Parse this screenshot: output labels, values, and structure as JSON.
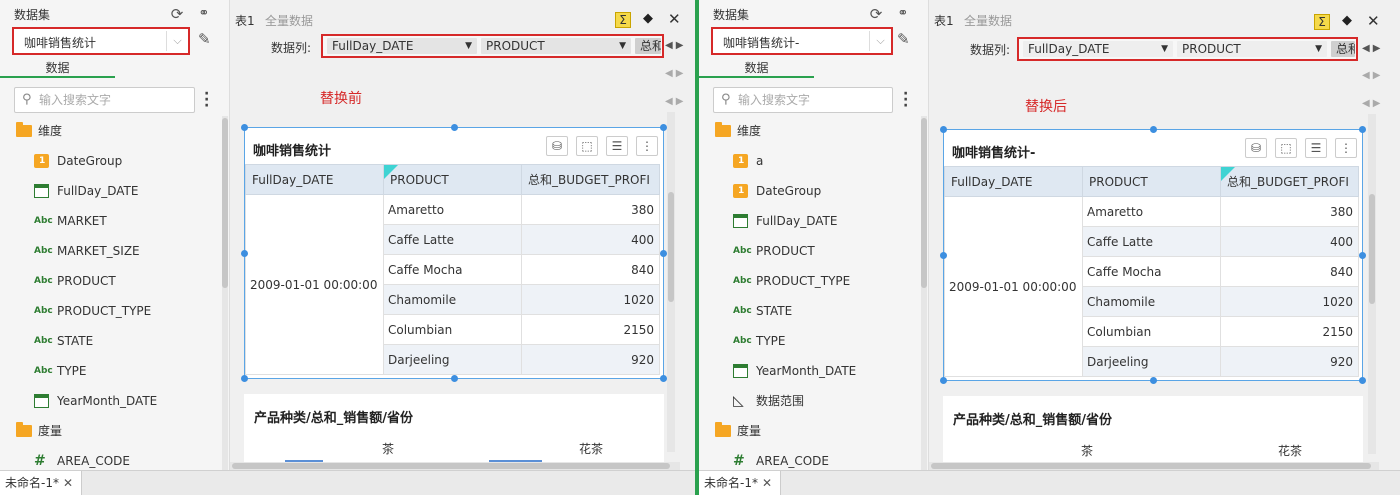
{
  "panes": [
    {
      "sidebar": {
        "title": "数据集",
        "dataset_value": "咖啡销售统计",
        "tab_label": "数据",
        "search_placeholder": "输入搜索文字",
        "tree": [
          {
            "label": "维度"
          },
          {
            "label": "DateGroup"
          },
          {
            "label": "FullDay_DATE"
          },
          {
            "label": "MARKET"
          },
          {
            "label": "MARKET_SIZE"
          },
          {
            "label": "PRODUCT"
          },
          {
            "label": "PRODUCT_TYPE"
          },
          {
            "label": "STATE"
          },
          {
            "label": "TYPE"
          },
          {
            "label": "YearMonth_DATE"
          },
          {
            "label": "度量"
          },
          {
            "label": "AREA_CODE"
          }
        ]
      },
      "topbar": {
        "tab1": "表1",
        "tab2": "全量数据",
        "sigma": "Σ"
      },
      "columns_label": "数据列:",
      "columns": [
        "FullDay_DATE",
        "PRODUCT",
        "总和"
      ],
      "note": "替换前",
      "widget": {
        "title": "咖啡销售统计",
        "headers": [
          "FullDay_DATE",
          "PRODUCT",
          "总和_BUDGET_PROFI"
        ],
        "date_cell": "2009-01-01 00:00:00",
        "rows": [
          {
            "product": "Amaretto",
            "value": "380"
          },
          {
            "product": "Caffe Latte",
            "value": "400"
          },
          {
            "product": "Caffe Mocha",
            "value": "840"
          },
          {
            "product": "Chamomile",
            "value": "1020"
          },
          {
            "product": "Columbian",
            "value": "2150"
          },
          {
            "product": "Darjeeling",
            "value": "920"
          }
        ]
      },
      "widget2": {
        "title": "产品种类/总和_销售额/省份",
        "categories": [
          "茶",
          "花茶"
        ]
      },
      "sheet_tab": "未命名-1*"
    },
    {
      "sidebar": {
        "title": "数据集",
        "dataset_value": "咖啡销售统计-",
        "tab_label": "数据",
        "search_placeholder": "输入搜索文字",
        "tree": [
          {
            "label": "维度"
          },
          {
            "label": "a"
          },
          {
            "label": "DateGroup"
          },
          {
            "label": "FullDay_DATE"
          },
          {
            "label": "PRODUCT"
          },
          {
            "label": "PRODUCT_TYPE"
          },
          {
            "label": "STATE"
          },
          {
            "label": "TYPE"
          },
          {
            "label": "YearMonth_DATE"
          },
          {
            "label": "数据范围"
          },
          {
            "label": "度量"
          },
          {
            "label": "AREA_CODE"
          }
        ]
      },
      "topbar": {
        "tab1": "表1",
        "tab2": "全量数据",
        "sigma": "Σ"
      },
      "columns_label": "数据列:",
      "columns": [
        "FullDay_DATE",
        "PRODUCT",
        "总和"
      ],
      "note": "替换后",
      "widget": {
        "title": "咖啡销售统计-",
        "headers": [
          "FullDay_DATE",
          "PRODUCT",
          "总和_BUDGET_PROFI"
        ],
        "date_cell": "2009-01-01 00:00:00",
        "rows": [
          {
            "product": "Amaretto",
            "value": "380"
          },
          {
            "product": "Caffe Latte",
            "value": "400"
          },
          {
            "product": "Caffe Mocha",
            "value": "840"
          },
          {
            "product": "Chamomile",
            "value": "1020"
          },
          {
            "product": "Columbian",
            "value": "2150"
          },
          {
            "product": "Darjeeling",
            "value": "920"
          }
        ]
      },
      "widget2": {
        "title": "产品种类/总和_销售额/省份",
        "categories": [
          "茶",
          "花茶"
        ]
      },
      "sheet_tab": "未命名-1*"
    }
  ],
  "colors": {
    "accent_green": "#2aa14e",
    "highlight_red": "#d62929",
    "selection_blue": "#3d8fe0",
    "folder_orange": "#f5a623"
  }
}
